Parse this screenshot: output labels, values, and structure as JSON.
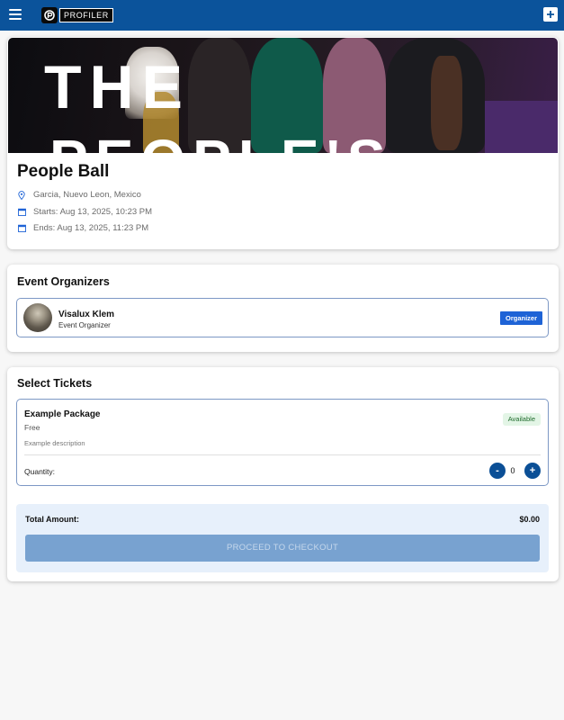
{
  "header": {
    "logo_text": "PROFILER",
    "menu_icon": "hamburger-menu-icon",
    "add_icon": "plus-icon",
    "background_color": "#0b539b"
  },
  "event": {
    "banner_text_line1": "THE",
    "banner_text_line2": "PEOPLE'S",
    "title": "People Ball",
    "location": "Garcia, Nuevo Leon, Mexico",
    "starts": "Starts: Aug 13, 2025, 10:23 PM",
    "ends": "Ends: Aug 13, 2025, 11:23 PM"
  },
  "organizers": {
    "heading": "Event Organizers",
    "items": [
      {
        "name": "Visalux Klem",
        "role": "Event Organizer",
        "badge": "Organizer"
      }
    ]
  },
  "tickets": {
    "heading": "Select Tickets",
    "packages": [
      {
        "name": "Example Package",
        "price": "Free",
        "description": "Example description",
        "status": "Available",
        "quantity_label": "Quantity:",
        "quantity": "0",
        "decrement_label": "-",
        "increment_label": "+"
      }
    ],
    "total_label": "Total Amount:",
    "total_value": "$0.00",
    "checkout_label": "PROCEED TO CHECKOUT"
  },
  "colors": {
    "primary": "#0b539b",
    "badge_blue": "#1e63d6",
    "available_bg": "#e3f5e6",
    "checkout_disabled": "#78a2d0"
  }
}
